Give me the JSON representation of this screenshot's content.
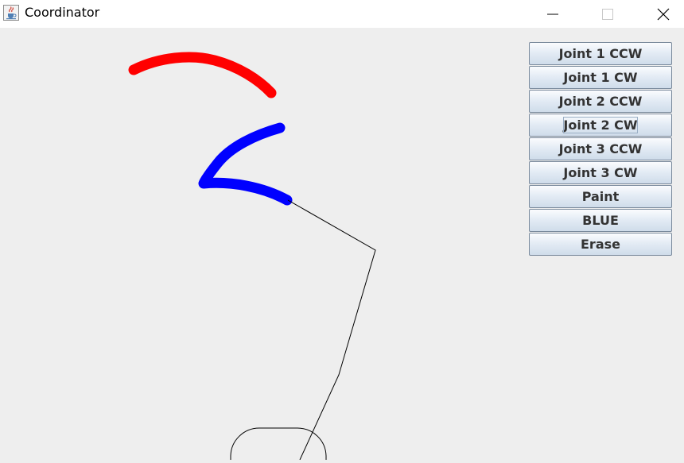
{
  "window": {
    "title": "Coordinator",
    "app_icon": "java-cup-icon",
    "controls": [
      "minimize-icon",
      "maximize-icon",
      "close-icon"
    ]
  },
  "buttons": [
    {
      "label": "Joint 1 CCW"
    },
    {
      "label": "Joint 1 CW"
    },
    {
      "label": "Joint 2 CCW"
    },
    {
      "label": "Joint 2 CW",
      "focused": true
    },
    {
      "label": "Joint 3 CCW"
    },
    {
      "label": "Joint 3 CW"
    },
    {
      "label": "Paint"
    },
    {
      "label": "BLUE"
    },
    {
      "label": "Erase"
    }
  ],
  "canvas": {
    "background": "#eeeeee",
    "stroke_colors": [
      "#ff0000",
      "#0000ff"
    ],
    "arm_color": "#000000"
  }
}
